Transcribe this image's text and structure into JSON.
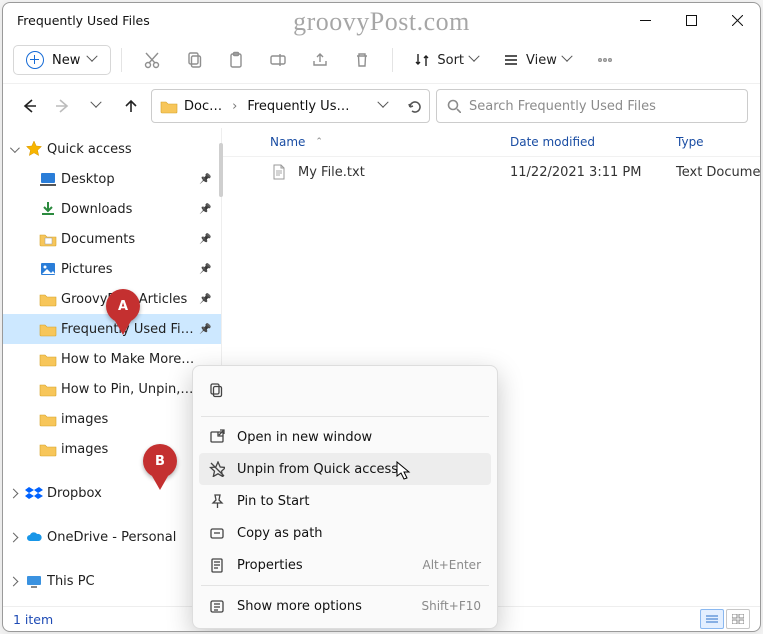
{
  "watermark": "groovyPost.com",
  "window": {
    "title": "Frequently Used Files"
  },
  "toolbar": {
    "new_label": "New",
    "sort_label": "Sort",
    "view_label": "View"
  },
  "address": {
    "seg1": "Doc…",
    "seg2": "Frequently Us…"
  },
  "search": {
    "placeholder": "Search Frequently Used Files"
  },
  "sidebar": {
    "top_label": "Quick access",
    "items": [
      {
        "label": "Desktop",
        "icon": "desktop",
        "pin": true
      },
      {
        "label": "Downloads",
        "icon": "download",
        "pin": true
      },
      {
        "label": "Documents",
        "icon": "docfolder",
        "pin": true
      },
      {
        "label": "Pictures",
        "icon": "pictures",
        "pin": true
      },
      {
        "label": "GroovyPost Articles",
        "icon": "folder",
        "pin": true
      },
      {
        "label": "Frequently Used Files",
        "icon": "folder",
        "pin": true,
        "selected": true
      },
      {
        "label": "How to Make More Spa",
        "icon": "folder",
        "pin": false
      },
      {
        "label": "How to Pin, Unpin, Hid",
        "icon": "folder",
        "pin": false
      },
      {
        "label": "images",
        "icon": "folder",
        "pin": false
      },
      {
        "label": "images",
        "icon": "folder",
        "pin": false
      }
    ],
    "dropbox": "Dropbox",
    "onedrive": "OneDrive - Personal",
    "thispc": "This PC"
  },
  "columns": {
    "name": "Name",
    "date": "Date modified",
    "type": "Type"
  },
  "rows": [
    {
      "name": "My File.txt",
      "date": "11/22/2021 3:11 PM",
      "type": "Text Document",
      "icon": "txt"
    }
  ],
  "context": {
    "open": "Open in new window",
    "unpin": "Unpin from Quick access",
    "pinstart": "Pin to Start",
    "copypath": "Copy as path",
    "properties": "Properties",
    "properties_sc": "Alt+Enter",
    "more": "Show more options",
    "more_sc": "Shift+F10"
  },
  "status": {
    "text": "1 item"
  },
  "markers": {
    "a": "A",
    "b": "B"
  }
}
